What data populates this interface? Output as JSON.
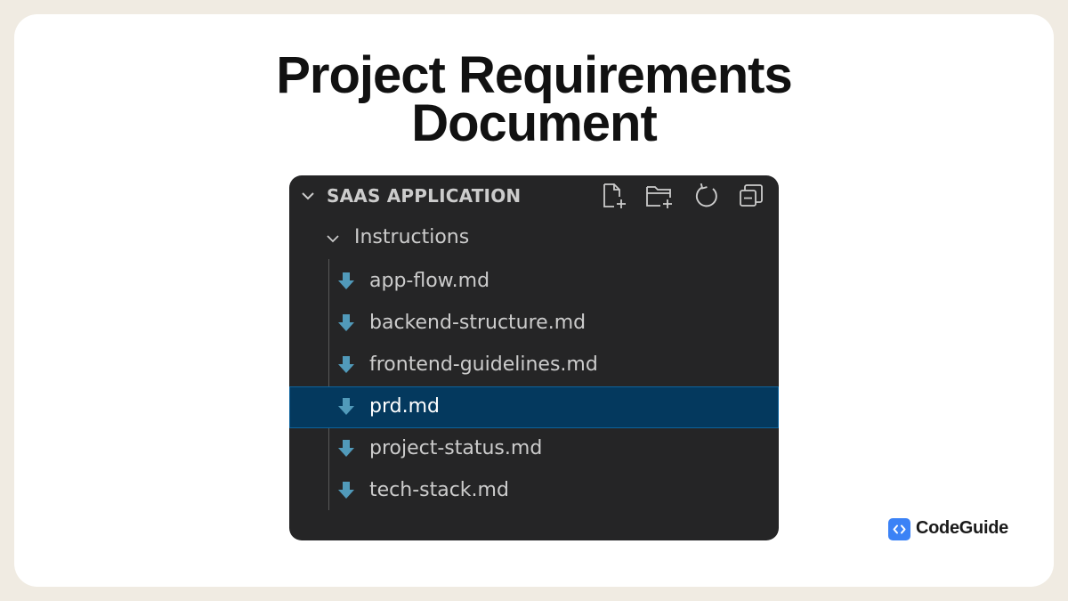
{
  "heading": {
    "line1": "Project Requirements",
    "line2": "Document"
  },
  "explorer": {
    "title": "SAAS APPLICATION",
    "toolbar": [
      "new-file-icon",
      "new-folder-icon",
      "refresh-icon",
      "collapse-all-icon"
    ],
    "folder": {
      "label": "Instructions",
      "expanded": true
    },
    "files": [
      {
        "name": "app-flow.md",
        "selected": false
      },
      {
        "name": "backend-structure.md",
        "selected": false
      },
      {
        "name": "frontend-guidelines.md",
        "selected": false
      },
      {
        "name": "prd.md",
        "selected": true
      },
      {
        "name": "project-status.md",
        "selected": false
      },
      {
        "name": "tech-stack.md",
        "selected": false
      }
    ],
    "file_icon": "markdown-down-arrow-icon"
  },
  "brand": {
    "name": "CodeGuide",
    "icon": "code-brackets-icon"
  },
  "colors": {
    "background": "#f0ebe2",
    "card": "#ffffff",
    "panel": "#252526",
    "selected_row": "#04395e",
    "selected_border": "#0e639c",
    "file_icon": "#519aba",
    "brand_accent": "#3b82f6"
  }
}
